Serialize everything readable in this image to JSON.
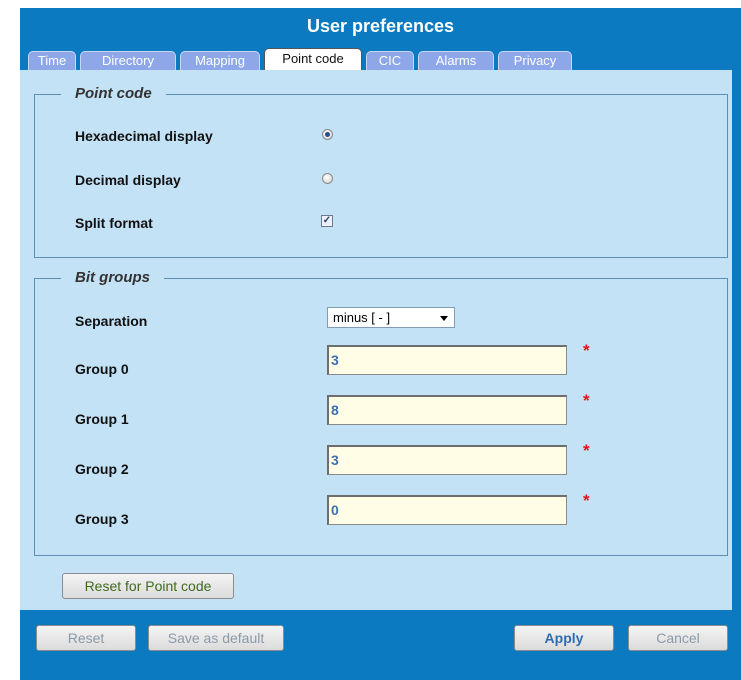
{
  "dialog": {
    "title": "User preferences"
  },
  "tabs": [
    {
      "label": "Time",
      "active": false
    },
    {
      "label": "Directory",
      "active": false
    },
    {
      "label": "Mapping",
      "active": false
    },
    {
      "label": "Point code",
      "active": true
    },
    {
      "label": "CIC",
      "active": false
    },
    {
      "label": "Alarms",
      "active": false
    },
    {
      "label": "Privacy",
      "active": false
    }
  ],
  "point_code": {
    "legend": "Point code",
    "hex_label": "Hexadecimal display",
    "hex_selected": true,
    "dec_label": "Decimal display",
    "dec_selected": false,
    "split_label": "Split format",
    "split_checked": true,
    "check_mark": "✓"
  },
  "bit_groups": {
    "legend": "Bit groups",
    "separation_label": "Separation",
    "separation_value": "minus [ - ]",
    "required_marker": "*",
    "groups": [
      {
        "label": "Group 0",
        "value": "3"
      },
      {
        "label": "Group 1",
        "value": "8"
      },
      {
        "label": "Group 2",
        "value": "3"
      },
      {
        "label": "Group 3",
        "value": "0"
      }
    ]
  },
  "buttons": {
    "reset_point_code": "Reset for Point code",
    "reset": "Reset",
    "save_default": "Save as default",
    "apply": "Apply",
    "cancel": "Cancel"
  },
  "colors": {
    "dialog_bg": "#0b7ac1",
    "panel_bg": "#c4e2f5",
    "tab_inactive": "#8ea7e9",
    "field_bg": "#fffde6",
    "required": "#e3131b"
  }
}
